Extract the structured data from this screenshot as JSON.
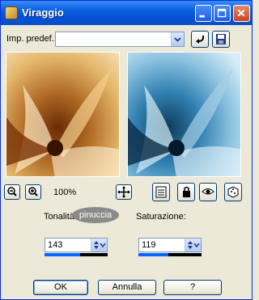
{
  "window": {
    "title": "Viraggio"
  },
  "colors": {
    "title_bar": "#0a5fe0",
    "accent_fill": "#0a64ff",
    "sepia": "#b07a3a",
    "cyan": "#3a8cc0"
  },
  "toolbar": {
    "preset_label": "Imp. predef.:",
    "preset_value": ""
  },
  "zoom": {
    "level": "100%"
  },
  "params": {
    "hue_label": "Tonalità:",
    "hue_value": "143",
    "hue_fraction": 0.56,
    "saturation_label": "Saturazione:",
    "saturation_value": "119",
    "saturation_fraction": 0.47
  },
  "watermark": "pinuccia",
  "buttons": {
    "ok": "OK",
    "cancel": "Annulla",
    "help": "?"
  },
  "icons": [
    "minimize-icon",
    "maximize-icon",
    "close-icon",
    "chevron-down-icon",
    "reset-arrow-icon",
    "save-disk-icon",
    "zoom-out-icon",
    "zoom-in-icon",
    "move-icon",
    "preview-list-icon",
    "lock-icon",
    "eye-icon",
    "dice-icon",
    "spin-arrows-icon"
  ]
}
